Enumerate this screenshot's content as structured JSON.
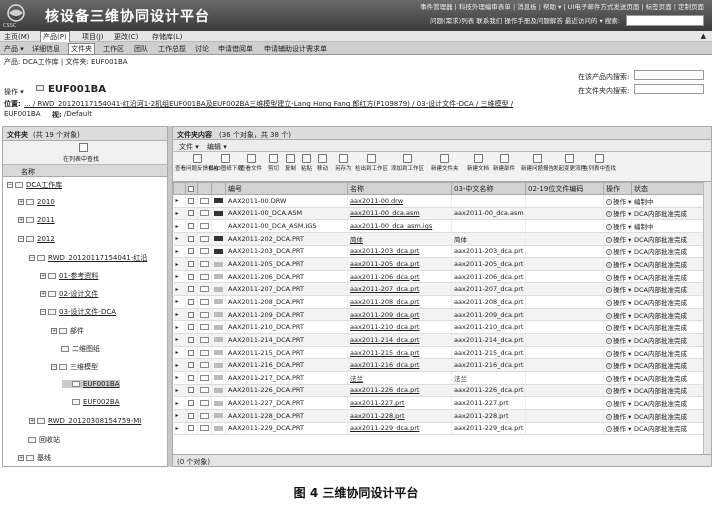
{
  "app": {
    "org_logo_text": "CSSC",
    "title": "核设备三维协同设计平台",
    "toplinks_row1": "事件管理器 | 科技外理编审表单 | 消息板 | 帮助 ▾ | UI电子邮件方式发送页面 | 标签页面 | 定制页面",
    "toplinks_row2": "问题(需求)列表   联系我们   操作手册及问题解答   最近访问的 ▾   搜索:"
  },
  "main_menu": [
    {
      "label": "主页(M)"
    },
    {
      "label": "产品(P)"
    },
    {
      "label": "项目(J)"
    },
    {
      "label": "更改(C)"
    },
    {
      "label": "存储库(L)"
    }
  ],
  "tabs": [
    {
      "label": "产品 ▾"
    },
    {
      "label": "详细信息"
    },
    {
      "label": "文件夹"
    },
    {
      "label": "工作区"
    },
    {
      "label": "团队"
    },
    {
      "label": "工作总揽"
    },
    {
      "label": "讨论"
    },
    {
      "label": "申请借阅单"
    },
    {
      "label": "申请辅助设计需求单"
    }
  ],
  "context": {
    "product_line": "产品: DCA工作库 | 文件夹: EUF001BA",
    "ops": "操作 ▾",
    "folder_name": "EUF001BA",
    "search_product_label": "在该产品内搜索:",
    "search_folder_label": "在文件夹内搜索:",
    "location_label": "位置:",
    "location_path": "... / RWD_20120117154041-红沿河1-2机组EUF001BA及EUF002BA三维模型建立-Lang Hong Fang 郎红方(P109879) / 03-设计文件-DCA / 三维模型 /",
    "location_tail": "EUF001BA",
    "view_label": "视:",
    "view_value": "/Default"
  },
  "left": {
    "title": "文件夹",
    "count": "(共 19 个对象)",
    "tool_label": "在列表中查找",
    "col_name": "名称",
    "tree": [
      {
        "label": "DCA工作库",
        "indent": 0,
        "toggle": "−",
        "link": true
      },
      {
        "label": "2010",
        "indent": 1,
        "toggle": "+",
        "link": true
      },
      {
        "label": "2011",
        "indent": 1,
        "toggle": "+",
        "link": true
      },
      {
        "label": "2012",
        "indent": 1,
        "toggle": "−",
        "link": true
      },
      {
        "label": "RWD_20120117154041-红沿",
        "indent": 2,
        "toggle": "−",
        "link": true
      },
      {
        "label": "01-参考资料",
        "indent": 3,
        "toggle": "+",
        "link": true
      },
      {
        "label": "02-设计文件",
        "indent": 3,
        "toggle": "+",
        "link": true
      },
      {
        "label": "03-设计文件-DCA",
        "indent": 3,
        "toggle": "−",
        "link": true
      },
      {
        "label": "部件",
        "indent": 4,
        "toggle": "+",
        "link": false
      },
      {
        "label": "二维图纸",
        "indent": 4,
        "toggle": "",
        "link": false
      },
      {
        "label": "三维模型",
        "indent": 4,
        "toggle": "−",
        "link": false
      },
      {
        "label": "EUF001BA",
        "indent": 5,
        "toggle": "",
        "link": true,
        "selected": true
      },
      {
        "label": "EUF002BA",
        "indent": 5,
        "toggle": "",
        "link": true
      },
      {
        "label": "RWD_20120308154759-MI",
        "indent": 2,
        "toggle": "+",
        "link": true
      },
      {
        "label": "回收站",
        "indent": 1,
        "toggle": "",
        "link": false
      },
      {
        "label": "基线",
        "indent": 1,
        "toggle": "+",
        "link": false
      }
    ]
  },
  "right": {
    "title": "文件夹内容",
    "count": "(36 个对象，共 38 个)",
    "menu": [
      "文件 ▾",
      "编辑 ▾"
    ],
    "toolbar": [
      "查看问题反馈报告",
      "CAD图纸下载",
      "查看文件",
      "剪切",
      "复制",
      "粘贴",
      "移动",
      "另存为",
      "检出到工作区",
      "添加到工作区",
      "新建文件夹",
      "新建文档",
      "新建部件",
      "新建问题报告",
      "发起变更流程",
      "在列表中查找"
    ],
    "columns": [
      "编号",
      "名称",
      "03-中文名称",
      "02-19位文件编码",
      "操作",
      "状态"
    ],
    "rows": [
      {
        "num": "AAX2011-00.DRW",
        "name": "aax2011-00.drw",
        "cn": "",
        "code": "",
        "op": "操作 ▾",
        "state": "编制中",
        "thumb": "dark",
        "nolink": false
      },
      {
        "num": "AAX2011-00_DCA.ASM",
        "name": "aax2011-00_dca.asm",
        "cn": "aax2011-00_dca.asm",
        "code": "",
        "op": "操作 ▾",
        "state": "DCA内部批准完成",
        "thumb": "dark",
        "nolink": false
      },
      {
        "num": "AAX2011-00_DCA_ASM.IGS",
        "name": "aax2011-00_dca_asm.igs",
        "cn": "",
        "code": "",
        "op": "操作 ▾",
        "state": "编制中",
        "thumb": "none",
        "nolink": false
      },
      {
        "num": "AAX2011-202_DCA.PRT",
        "name": "简体",
        "cn": "简体",
        "code": "",
        "op": "操作 ▾",
        "state": "DCA内部批准完成",
        "thumb": "dark",
        "nolink": true
      },
      {
        "num": "AAX2011-203_DCA.PRT",
        "name": "aax2011-203_dca.prt",
        "cn": "aax2011-203_dca.prt",
        "code": "",
        "op": "操作 ▾",
        "state": "DCA内部批准完成",
        "thumb": "dark",
        "nolink": false
      },
      {
        "num": "AAX2011-205_DCA.PRT",
        "name": "aax2011-205_dca.prt",
        "cn": "aax2011-205_dca.prt",
        "code": "",
        "op": "操作 ▾",
        "state": "DCA内部批准完成",
        "thumb": "light",
        "nolink": false
      },
      {
        "num": "AAX2011-206_DCA.PRT",
        "name": "aax2011-206_dca.prt",
        "cn": "aax2011-206_dca.prt",
        "code": "",
        "op": "操作 ▾",
        "state": "DCA内部批准完成",
        "thumb": "light",
        "nolink": false
      },
      {
        "num": "AAX2011-207_DCA.PRT",
        "name": "aax2011-207_dca.prt",
        "cn": "aax2011-207_dca.prt",
        "code": "",
        "op": "操作 ▾",
        "state": "DCA内部批准完成",
        "thumb": "light",
        "nolink": false
      },
      {
        "num": "AAX2011-208_DCA.PRT",
        "name": "aax2011-208_dca.prt",
        "cn": "aax2011-208_dca.prt",
        "code": "",
        "op": "操作 ▾",
        "state": "DCA内部批准完成",
        "thumb": "light",
        "nolink": false
      },
      {
        "num": "AAX2011-209_DCA.PRT",
        "name": "aax2011-209_dca.prt",
        "cn": "aax2011-209_dca.prt",
        "code": "",
        "op": "操作 ▾",
        "state": "DCA内部批准完成",
        "thumb": "light",
        "nolink": false
      },
      {
        "num": "AAX2011-210_DCA.PRT",
        "name": "aax2011-210_dca.prt",
        "cn": "aax2011-210_dca.prt",
        "code": "",
        "op": "操作 ▾",
        "state": "DCA内部批准完成",
        "thumb": "light",
        "nolink": false
      },
      {
        "num": "AAX2011-214_DCA.PRT",
        "name": "aax2011-214_dca.prt",
        "cn": "aax2011-214_dca.prt",
        "code": "",
        "op": "操作 ▾",
        "state": "DCA内部批准完成",
        "thumb": "light",
        "nolink": false
      },
      {
        "num": "AAX2011-215_DCA.PRT",
        "name": "aax2011-215_dca.prt",
        "cn": "aax2011-215_dca.prt",
        "code": "",
        "op": "操作 ▾",
        "state": "DCA内部批准完成",
        "thumb": "light",
        "nolink": false
      },
      {
        "num": "AAX2011-216_DCA.PRT",
        "name": "aax2011-216_dca.prt",
        "cn": "aax2011-216_dca.prt",
        "code": "",
        "op": "操作 ▾",
        "state": "DCA内部批准完成",
        "thumb": "light",
        "nolink": false
      },
      {
        "num": "AAX2011-217_DCA.PRT",
        "name": "法兰",
        "cn": "法兰",
        "code": "",
        "op": "操作 ▾",
        "state": "DCA内部批准完成",
        "thumb": "light",
        "nolink": true
      },
      {
        "num": "AAX2011-226_DCA.PRT",
        "name": "aax2011-226_dca.prt",
        "cn": "aax2011-226_dca.prt",
        "code": "",
        "op": "操作 ▾",
        "state": "DCA内部批准完成",
        "thumb": "light",
        "nolink": false
      },
      {
        "num": "AAX2011-227_DCA.PRT",
        "name": "aax2011-227.prt",
        "cn": "aax2011-227.prt",
        "code": "",
        "op": "操作 ▾",
        "state": "DCA内部批准完成",
        "thumb": "light",
        "nolink": false
      },
      {
        "num": "AAX2011-228_DCA.PRT",
        "name": "aax2011-228.prt",
        "cn": "aax2011-228.prt",
        "code": "",
        "op": "操作 ▾",
        "state": "DCA内部批准完成",
        "thumb": "light",
        "nolink": false
      },
      {
        "num": "AAX2011-229_DCA.PRT",
        "name": "aax2011-229_dca.prt",
        "cn": "aax2011-229_dca.prt",
        "code": "",
        "op": "操作 ▾",
        "state": "DCA内部批准完成",
        "thumb": "light",
        "nolink": false
      }
    ],
    "status": "(0 个对象)"
  },
  "caption": "图 4  三维协同设计平台"
}
